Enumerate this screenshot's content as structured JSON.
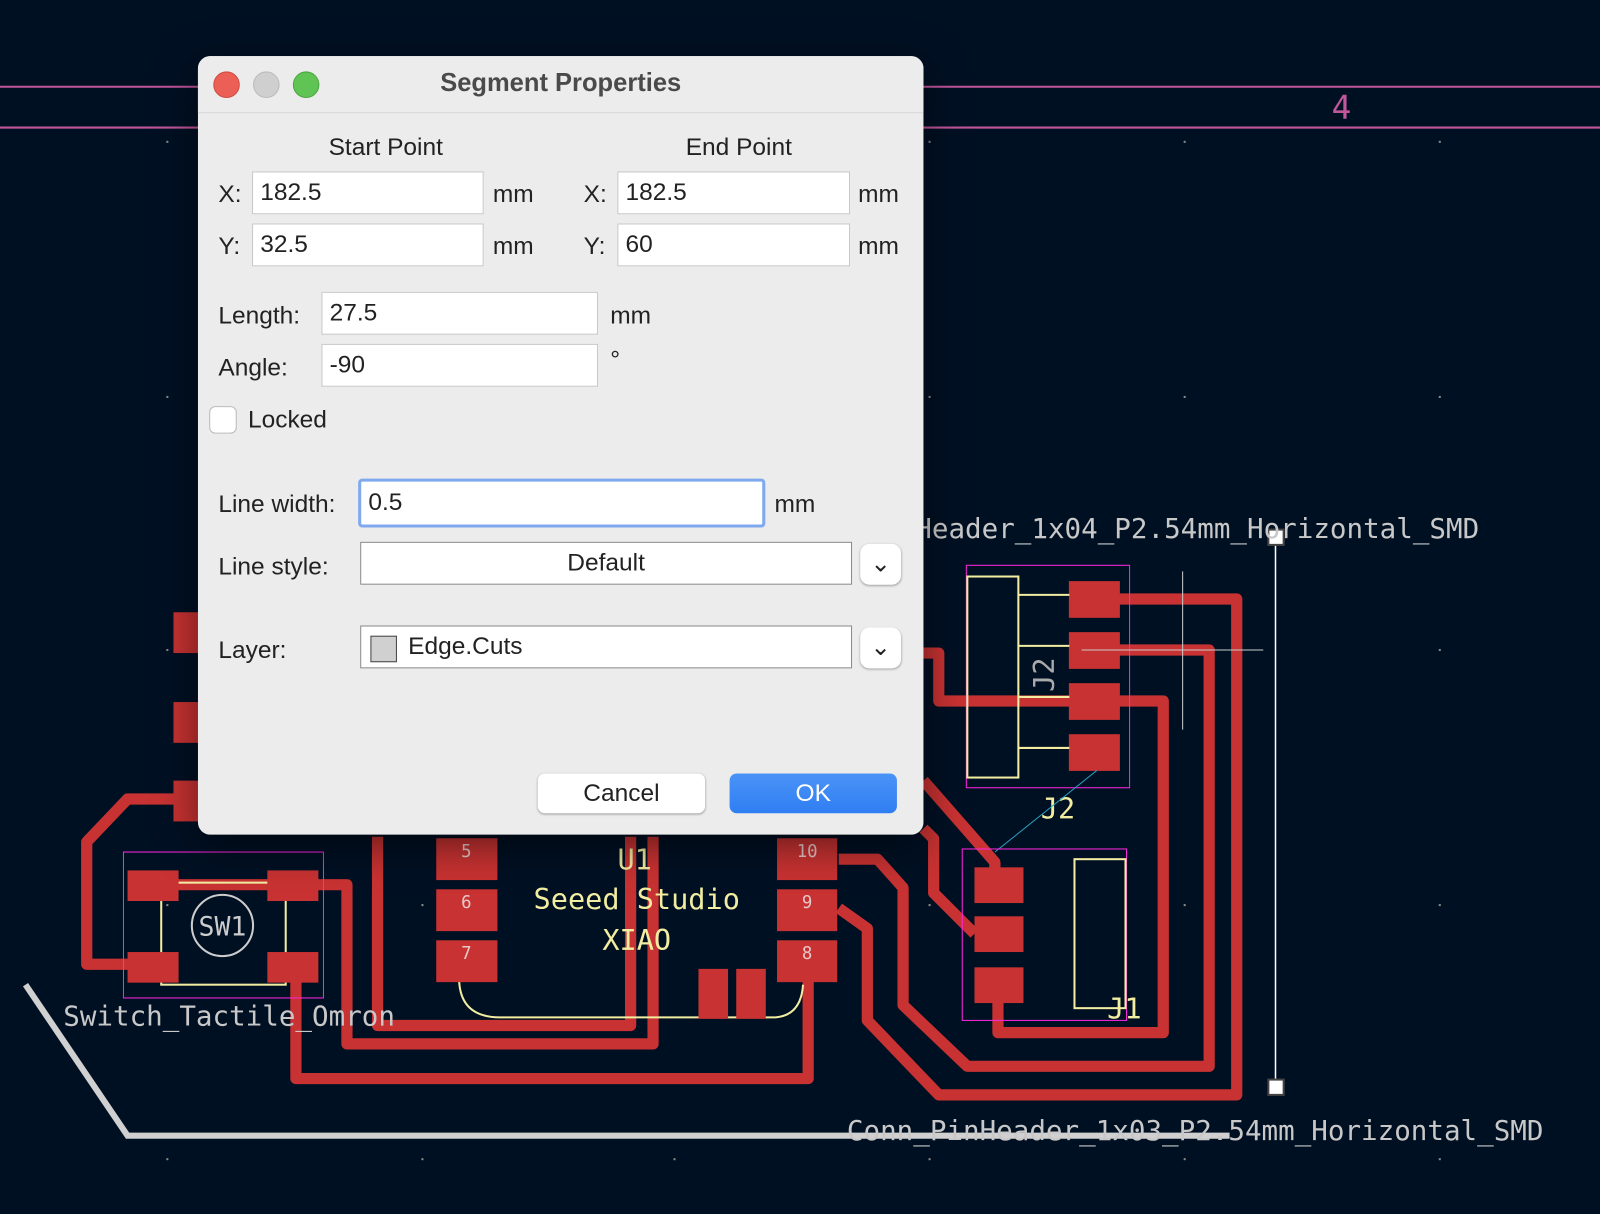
{
  "dialog": {
    "title": "Segment Properties",
    "start_point": {
      "heading": "Start Point",
      "x_label": "X:",
      "x_value": "182.5",
      "y_label": "Y:",
      "y_value": "32.5",
      "unit": "mm"
    },
    "end_point": {
      "heading": "End Point",
      "x_label": "X:",
      "x_value": "182.5",
      "y_label": "Y:",
      "y_value": "60",
      "unit": "mm"
    },
    "length": {
      "label": "Length:",
      "value": "27.5",
      "unit": "mm"
    },
    "angle": {
      "label": "Angle:",
      "value": "-90",
      "unit": "°"
    },
    "locked": {
      "label": "Locked",
      "checked": false
    },
    "line_width": {
      "label": "Line width:",
      "value": "0.5",
      "unit": "mm"
    },
    "line_style": {
      "label": "Line style:",
      "value": "Default"
    },
    "layer": {
      "label": "Layer:",
      "value": "Edge.Cuts",
      "swatch_color": "#d0d0d0"
    },
    "cancel_label": "Cancel",
    "ok_label": "OK",
    "accent_color": "#3a86f5"
  },
  "pcb": {
    "sheet_marker": "4",
    "j2_fp_text": "Header_1x04_P2.54mm_Horizontal_SMD",
    "j1_fp_text": "Conn_PinHeader_1x03_P2.54mm_Horizontal_SMD",
    "sw1_fp_text": "Switch_Tactile_Omron",
    "sw1_ref": "SW1",
    "j2_ref": "J2",
    "j1_ref": "J1",
    "u1_ref": "U1",
    "u1_value_line1": "Seeed Studio",
    "u1_value_line2": "XIAO",
    "u1_pads": [
      "5",
      "6",
      "7",
      "10",
      "9",
      "8"
    ],
    "colors": {
      "copper": "#c83232",
      "silkscreen": "#f2eda1",
      "courtyard": "#ff26e2",
      "edge_cuts": "#d0d0d0",
      "background": "#001023"
    }
  }
}
